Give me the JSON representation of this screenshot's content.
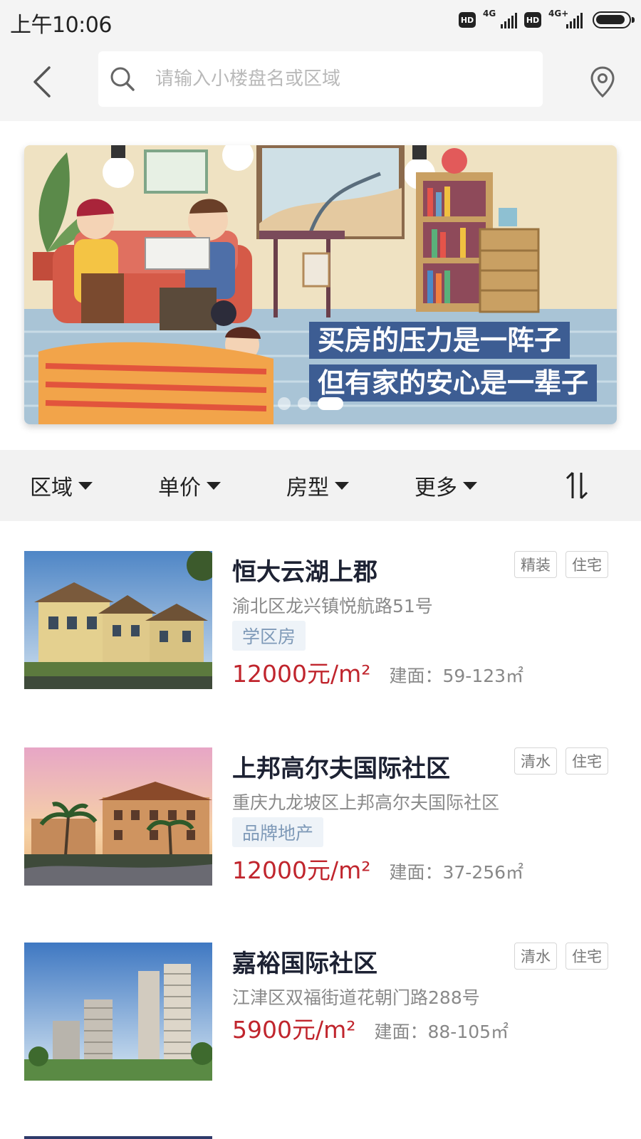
{
  "status_bar": {
    "time": "上午10:06",
    "hd1": "HD",
    "net1": "4G",
    "hd2": "HD",
    "net2": "4G+"
  },
  "header": {
    "search_placeholder": "请输入小楼盘名或区域",
    "icons": [
      "chevron-left-icon",
      "search-icon",
      "location-pin-icon"
    ]
  },
  "banner": {
    "line1": "买房的压力是一阵子",
    "line2": "但有家的安心是一辈子",
    "dots": 3,
    "active_dot": 3,
    "caption_bg": "#3d5d93"
  },
  "filters": {
    "items": [
      {
        "label": "区域"
      },
      {
        "label": "单价"
      },
      {
        "label": "房型"
      },
      {
        "label": "更多"
      }
    ],
    "sort_icon": "sort-arrows-icon"
  },
  "listings": [
    {
      "title": "恒大云湖上郡",
      "tags": [
        "精装",
        "住宅"
      ],
      "address": "渝北区龙兴镇悦航路51号",
      "feature": "学区房",
      "price": "12000元/m²",
      "area_label": "建面：",
      "area_value": "59-123㎡"
    },
    {
      "title": "上邦高尔夫国际社区",
      "tags": [
        "清水",
        "住宅"
      ],
      "address": "重庆九龙坡区上邦高尔夫国际社区",
      "feature": "品牌地产",
      "price": "12000元/m²",
      "area_label": "建面：",
      "area_value": "37-256㎡"
    },
    {
      "title": "嘉裕国际社区",
      "tags": [
        "清水",
        "住宅"
      ],
      "address": "江津区双福街道花朝门路288号",
      "feature": "",
      "price": "5900元/m²",
      "area_label": "建面：",
      "area_value": "88-105㎡"
    }
  ],
  "colors": {
    "price": "#c0252d",
    "feature_bg": "#eef3f8",
    "feature_text": "#7f9ab8",
    "header_bg": "#f4f4f4"
  }
}
